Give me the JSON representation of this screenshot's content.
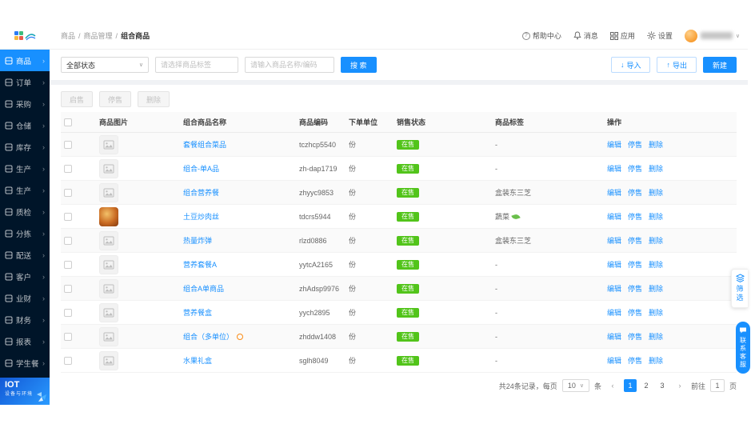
{
  "colors": {
    "primary": "#1890ff",
    "success": "#52c41a",
    "sidebar_bg": "#001529",
    "avatar": "#f79b2e"
  },
  "icons": {
    "help": "?",
    "caret": "∨",
    "prev": "‹",
    "next": "›",
    "sep": "/",
    "down": "↓",
    "up": "↑",
    "chevron": "›"
  },
  "breadcrumb": {
    "items": [
      "商品",
      "商品管理",
      "组合商品"
    ]
  },
  "topbar": {
    "help": "帮助中心",
    "message": "消息",
    "apps": "应用",
    "settings": "设置"
  },
  "sidebar": {
    "items": [
      {
        "label": "商品",
        "active": true
      },
      {
        "label": "订单"
      },
      {
        "label": "采购"
      },
      {
        "label": "仓储"
      },
      {
        "label": "库存"
      },
      {
        "label": "生产"
      },
      {
        "label": "生产"
      },
      {
        "label": "质检"
      },
      {
        "label": "分拣"
      },
      {
        "label": "配送"
      },
      {
        "label": "客户"
      },
      {
        "label": "业财"
      },
      {
        "label": "财务"
      },
      {
        "label": "报表"
      },
      {
        "label": "学生餐"
      }
    ],
    "brand": {
      "title": "IOT",
      "subtitle": "设备与环境"
    }
  },
  "filters": {
    "status": "全部状态",
    "tag_placeholder": "请选择商品标签",
    "keyword_placeholder": "请输入商品名称/编码",
    "search": "搜 索"
  },
  "toolbar": {
    "import": "导入",
    "export": "导出",
    "create": "新建"
  },
  "bulk": {
    "enable": "启售",
    "disable": "停售",
    "delete": "删除"
  },
  "table": {
    "columns": [
      "商品图片",
      "组合商品名称",
      "商品编码",
      "下单单位",
      "销售状态",
      "商品标签",
      "操作"
    ],
    "row_actions": [
      "编辑",
      "停售",
      "删除"
    ],
    "rows": [
      {
        "name": "套餐组合菜品",
        "code": "tczhcp5540",
        "unit": "份",
        "status": "在售",
        "tag": "-",
        "photo": "placeholder"
      },
      {
        "name": "组合-单A品",
        "code": "zh-dap1719",
        "unit": "份",
        "status": "在售",
        "tag": "-",
        "photo": "placeholder"
      },
      {
        "name": "组合营养餐",
        "code": "zhyyc9853",
        "unit": "份",
        "status": "在售",
        "tag": "盒装东三芝",
        "photo": "placeholder"
      },
      {
        "name": "土豆炒肉丝",
        "code": "tdcrs5944",
        "unit": "份",
        "status": "在售",
        "tag": "蔬菜",
        "tag_icon": "leaf",
        "photo": "dish"
      },
      {
        "name": "热量炸弹",
        "code": "rlzd0886",
        "unit": "份",
        "status": "在售",
        "tag": "盒装东三芝",
        "photo": "placeholder"
      },
      {
        "name": "营养套餐A",
        "code": "yytcA2165",
        "unit": "份",
        "status": "在售",
        "tag": "-",
        "photo": "placeholder"
      },
      {
        "name": "组合A单商品",
        "code": "zhAdsp9976",
        "unit": "份",
        "status": "在售",
        "tag": "-",
        "photo": "placeholder"
      },
      {
        "name": "营养餐盒",
        "code": "yych2895",
        "unit": "份",
        "status": "在售",
        "tag": "-",
        "photo": "placeholder"
      },
      {
        "name": "组合（多单位）",
        "code": "zhddw1408",
        "unit": "份",
        "status": "在售",
        "tag": "-",
        "photo": "placeholder",
        "warn": true
      },
      {
        "name": "水果礼盒",
        "code": "sglh8049",
        "unit": "份",
        "status": "在售",
        "tag": "-",
        "photo": "placeholder"
      }
    ]
  },
  "pagination": {
    "total_label": "共24条记录，每页",
    "per_page": "10",
    "unit_label": "条",
    "pages": [
      "1",
      "2",
      "3"
    ],
    "current": "1",
    "goto_label": "前往",
    "goto_value": "1",
    "page_label": "页"
  },
  "floaters": {
    "filter": "筛选",
    "service": "联系客服"
  }
}
